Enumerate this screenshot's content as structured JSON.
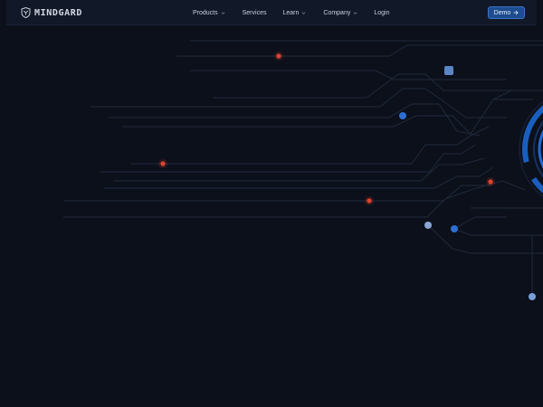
{
  "brand": {
    "name": "MINDGARD",
    "logo_icon": "shield-logo-icon"
  },
  "nav": {
    "items": [
      {
        "label": "Products",
        "has_dropdown": true
      },
      {
        "label": "Services",
        "has_dropdown": false
      },
      {
        "label": "Learn",
        "has_dropdown": true
      },
      {
        "label": "Company",
        "has_dropdown": true
      },
      {
        "label": "Login",
        "has_dropdown": false
      }
    ],
    "cta": {
      "label": "Demo",
      "icon": "arrow-right-icon"
    }
  },
  "colors": {
    "background": "#0c101b",
    "navbar": "#111827",
    "accent_blue": "#1d4c8f",
    "node_red": "#e0432f",
    "node_blue": "#2e6fd1",
    "node_light_blue": "#7a9ed8",
    "trace": "#1f2a3b"
  }
}
